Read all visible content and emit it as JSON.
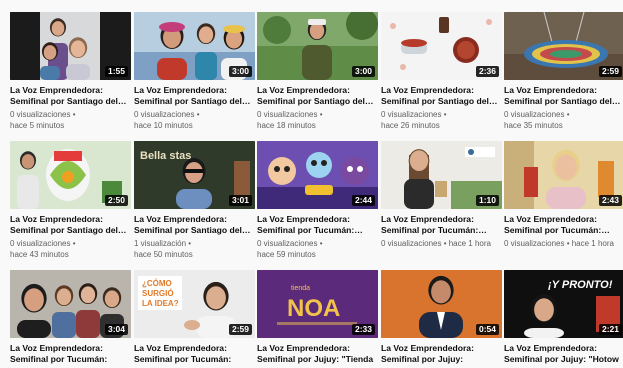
{
  "videos": [
    {
      "title": "La Voz Emprendedora:\nSemifinal por Santiago del…",
      "duration": "1:55",
      "meta1": "0 visualizaciones •",
      "meta2": "hace 5 minutos",
      "scene": "interview"
    },
    {
      "title": "La Voz Emprendedora:\nSemifinal por Santiago del…",
      "duration": "3:00",
      "meta1": "0 visualizaciones •",
      "meta2": "hace 10 minutos",
      "scene": "selfie"
    },
    {
      "title": "La Voz Emprendedora:\nSemifinal por Santiago del…",
      "duration": "3:00",
      "meta1": "0 visualizaciones •",
      "meta2": "hace 18 minutos",
      "scene": "garden"
    },
    {
      "title": "La Voz Emprendedora:\nSemifinal por Santiago del…",
      "duration": "2:36",
      "meta1": "0 visualizaciones •",
      "meta2": "hace 26 minutos",
      "scene": "petfood"
    },
    {
      "title": "La Voz Emprendedora:\nSemifinal por Santiago del…",
      "duration": "2:59",
      "meta1": "0 visualizaciones •",
      "meta2": "hace 35 minutos",
      "scene": "hammock"
    },
    {
      "title": "La Voz Emprendedora:\nSemifinal por Santiago del…",
      "duration": "2:50",
      "meta1": "0 visualizaciones •",
      "meta2": "hace 43 minutos",
      "scene": "logo"
    },
    {
      "title": "La Voz Emprendedora:\nSemifinal por Santiago del…",
      "duration": "3:01",
      "meta1": "1 visualización •",
      "meta2": "hace 50 minutos",
      "scene": "bellavistas",
      "sign": "Bella  stas"
    },
    {
      "title": "La Voz Emprendedora:\nSemifinal por Tucumán:…",
      "duration": "2:44",
      "meta1": "0 visualizaciones •",
      "meta2": "hace 59 minutos",
      "scene": "cartoon"
    },
    {
      "title": "La Voz Emprendedora:\nSemifinal por Tucumán:…",
      "duration": "1:10",
      "meta1": "0 visualizaciones • hace 1 hora",
      "meta2": "",
      "scene": "woman"
    },
    {
      "title": "La Voz Emprendedora:\nSemifinal por Tucumán:…",
      "duration": "2:43",
      "meta1": "0 visualizaciones • hace 1 hora",
      "meta2": "",
      "scene": "blonde"
    },
    {
      "title": "La Voz Emprendedora:\nSemifinal por Tucumán:",
      "duration": "3:04",
      "meta1": "",
      "meta2": "",
      "scene": "group"
    },
    {
      "title": "La Voz Emprendedora:\nSemifinal por Tucumán:",
      "duration": "2:59",
      "meta1": "",
      "meta2": "",
      "scene": "idea",
      "sign": "¿CÓMO\nSURGIÓ\nLA IDEA?"
    },
    {
      "title": "La Voz Emprendedora:\nSemifinal por Jujuy: \"Tienda",
      "duration": "2:33",
      "meta1": "",
      "meta2": "",
      "scene": "noa",
      "sign": "tienda\nNOA"
    },
    {
      "title": "La Voz Emprendedora:\nSemifinal por Jujuy:",
      "duration": "0:54",
      "meta1": "",
      "meta2": "",
      "scene": "suit"
    },
    {
      "title": "La Voz Emprendedora:\nSemifinal por Jujuy: \"Hotow",
      "duration": "2:21",
      "meta1": "",
      "meta2": "",
      "scene": "pronto",
      "sign": "¡Y PRONTO!"
    }
  ]
}
